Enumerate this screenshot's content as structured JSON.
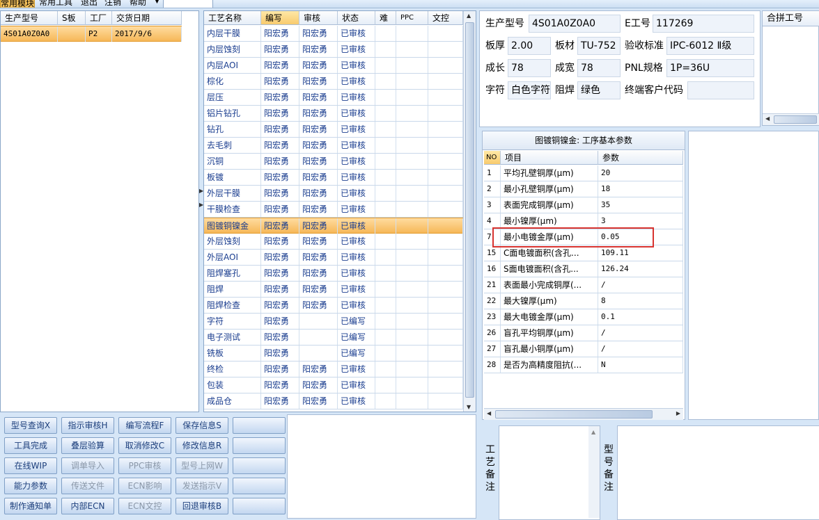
{
  "menu": {
    "items": [
      "常用模块",
      "常用工具",
      "退出",
      "注销",
      "帮助"
    ],
    "active_index": 0
  },
  "order_grid": {
    "columns": [
      "生产型号",
      "S板",
      "工厂",
      "交货日期"
    ],
    "rows": [
      {
        "model": "4S01A0Z0A0",
        "s_board": "",
        "factory": "P2",
        "delivery_date": "2017/9/6"
      }
    ]
  },
  "process_grid": {
    "columns": [
      "工艺名称",
      "编写",
      "审核",
      "状态",
      "难",
      "PPC",
      "文控"
    ],
    "selected_index": 12,
    "rows": [
      {
        "name": "内层干膜",
        "writer": "阳宏勇",
        "reviewer": "阳宏勇",
        "status": "已审核"
      },
      {
        "name": "内层蚀刻",
        "writer": "阳宏勇",
        "reviewer": "阳宏勇",
        "status": "已审核"
      },
      {
        "name": "内层AOI",
        "writer": "阳宏勇",
        "reviewer": "阳宏勇",
        "status": "已审核"
      },
      {
        "name": "棕化",
        "writer": "阳宏勇",
        "reviewer": "阳宏勇",
        "status": "已审核"
      },
      {
        "name": "层压",
        "writer": "阳宏勇",
        "reviewer": "阳宏勇",
        "status": "已审核"
      },
      {
        "name": "铝片钻孔",
        "writer": "阳宏勇",
        "reviewer": "阳宏勇",
        "status": "已审核"
      },
      {
        "name": "钻孔",
        "writer": "阳宏勇",
        "reviewer": "阳宏勇",
        "status": "已审核"
      },
      {
        "name": "去毛刺",
        "writer": "阳宏勇",
        "reviewer": "阳宏勇",
        "status": "已审核"
      },
      {
        "name": "沉铜",
        "writer": "阳宏勇",
        "reviewer": "阳宏勇",
        "status": "已审核"
      },
      {
        "name": "板镀",
        "writer": "阳宏勇",
        "reviewer": "阳宏勇",
        "status": "已审核"
      },
      {
        "name": "外层干膜",
        "writer": "阳宏勇",
        "reviewer": "阳宏勇",
        "status": "已审核"
      },
      {
        "name": "干膜检查",
        "writer": "阳宏勇",
        "reviewer": "阳宏勇",
        "status": "已审核"
      },
      {
        "name": "图镀铜镍金",
        "writer": "阳宏勇",
        "reviewer": "阳宏勇",
        "status": "已审核"
      },
      {
        "name": "外层蚀刻",
        "writer": "阳宏勇",
        "reviewer": "阳宏勇",
        "status": "已审核"
      },
      {
        "name": "外层AOI",
        "writer": "阳宏勇",
        "reviewer": "阳宏勇",
        "status": "已审核"
      },
      {
        "name": "阻焊塞孔",
        "writer": "阳宏勇",
        "reviewer": "阳宏勇",
        "status": "已审核"
      },
      {
        "name": "阻焊",
        "writer": "阳宏勇",
        "reviewer": "阳宏勇",
        "status": "已审核"
      },
      {
        "name": "阻焊检查",
        "writer": "阳宏勇",
        "reviewer": "阳宏勇",
        "status": "已审核"
      },
      {
        "name": "字符",
        "writer": "阳宏勇",
        "reviewer": "",
        "status": "已编写"
      },
      {
        "name": "电子测试",
        "writer": "阳宏勇",
        "reviewer": "",
        "status": "已编写"
      },
      {
        "name": "铣板",
        "writer": "阳宏勇",
        "reviewer": "",
        "status": "已编写"
      },
      {
        "name": "终检",
        "writer": "阳宏勇",
        "reviewer": "阳宏勇",
        "status": "已审核"
      },
      {
        "name": "包装",
        "writer": "阳宏勇",
        "reviewer": "阳宏勇",
        "status": "已审核"
      },
      {
        "name": "成品仓",
        "writer": "阳宏勇",
        "reviewer": "阳宏勇",
        "status": "已审核"
      }
    ]
  },
  "info": {
    "model_label": "生产型号",
    "model_value": "4S01A0Z0A0",
    "e_label": "E工号",
    "e_value": "117269",
    "thick_label": "板厚",
    "thick_value": "2.00",
    "material_label": "板材",
    "material_value": "TU-752",
    "std_label": "验收标准",
    "std_value": "IPC-6012 Ⅱ级",
    "length_label": "成长",
    "length_value": "78",
    "width_label": "成宽",
    "width_value": "78",
    "pnl_label": "PNL规格",
    "pnl_value": "1P=36U",
    "char_label": "字符",
    "char_value": "白色字符",
    "mask_label": "阻焊",
    "mask_value": "绿色",
    "cust_label": "终端客户代码",
    "cust_value": ""
  },
  "merge_panel": {
    "header": "合拼工号"
  },
  "params": {
    "title": "图镀铜镍金: 工序基本参数",
    "columns": [
      "NO",
      "项目",
      "参数"
    ],
    "highlight_index": 4,
    "rows": [
      {
        "no": "1",
        "item": "平均孔壁铜厚(μm)",
        "value": "20"
      },
      {
        "no": "2",
        "item": "最小孔壁铜厚(μm)",
        "value": "18"
      },
      {
        "no": "3",
        "item": "表面完成铜厚(μm)",
        "value": "35"
      },
      {
        "no": "4",
        "item": "最小镍厚(μm)",
        "value": "3"
      },
      {
        "no": "7",
        "item": "最小电镀金厚(μm)",
        "value": "0.05"
      },
      {
        "no": "15",
        "item": "C面电镀面积(含孔...",
        "value": "109.11"
      },
      {
        "no": "16",
        "item": "S面电镀面积(含孔...",
        "value": "126.24"
      },
      {
        "no": "21",
        "item": "表面最小完成铜厚(...",
        "value": "/"
      },
      {
        "no": "22",
        "item": "最大镍厚(μm)",
        "value": "8"
      },
      {
        "no": "23",
        "item": "最大电镀金厚(μm)",
        "value": "0.1"
      },
      {
        "no": "26",
        "item": "盲孔平均铜厚(μm)",
        "value": "/"
      },
      {
        "no": "27",
        "item": "盲孔最小铜厚(μm)",
        "value": "/"
      },
      {
        "no": "28",
        "item": "是否为高精度阻抗(...",
        "value": "N"
      }
    ]
  },
  "notes": {
    "process_label": "工艺备注",
    "model_label": "型号备注"
  },
  "buttons": [
    [
      {
        "label": "型号查询X",
        "enabled": true
      },
      {
        "label": "指示审核H",
        "enabled": true
      },
      {
        "label": "编写流程F",
        "enabled": true
      },
      {
        "label": "保存信息S",
        "enabled": true
      },
      {
        "label": "",
        "enabled": true
      }
    ],
    [
      {
        "label": "工具完成",
        "enabled": true
      },
      {
        "label": "叠层验算",
        "enabled": true
      },
      {
        "label": "取消修改C",
        "enabled": true
      },
      {
        "label": "修改信息R",
        "enabled": true
      },
      {
        "label": "",
        "enabled": true
      }
    ],
    [
      {
        "label": "在线WIP",
        "enabled": true
      },
      {
        "label": "调单导入",
        "enabled": false
      },
      {
        "label": "PPC审核",
        "enabled": false
      },
      {
        "label": "型号上网W",
        "enabled": false
      },
      {
        "label": "",
        "enabled": true
      }
    ],
    [
      {
        "label": "能力参数",
        "enabled": true
      },
      {
        "label": "传送文件",
        "enabled": false
      },
      {
        "label": "ECN影响",
        "enabled": false
      },
      {
        "label": "发送指示V",
        "enabled": false
      },
      {
        "label": "",
        "enabled": true
      }
    ],
    [
      {
        "label": "制作通知单",
        "enabled": true
      },
      {
        "label": "内部ECN",
        "enabled": true
      },
      {
        "label": "ECN文控",
        "enabled": false
      },
      {
        "label": "回退审核B",
        "enabled": true
      },
      {
        "label": "",
        "enabled": true
      }
    ]
  ],
  "colors": {
    "selected_row": "#f6b858",
    "highlight_box": "#d8332f",
    "button_text": "#1d3f7c"
  }
}
